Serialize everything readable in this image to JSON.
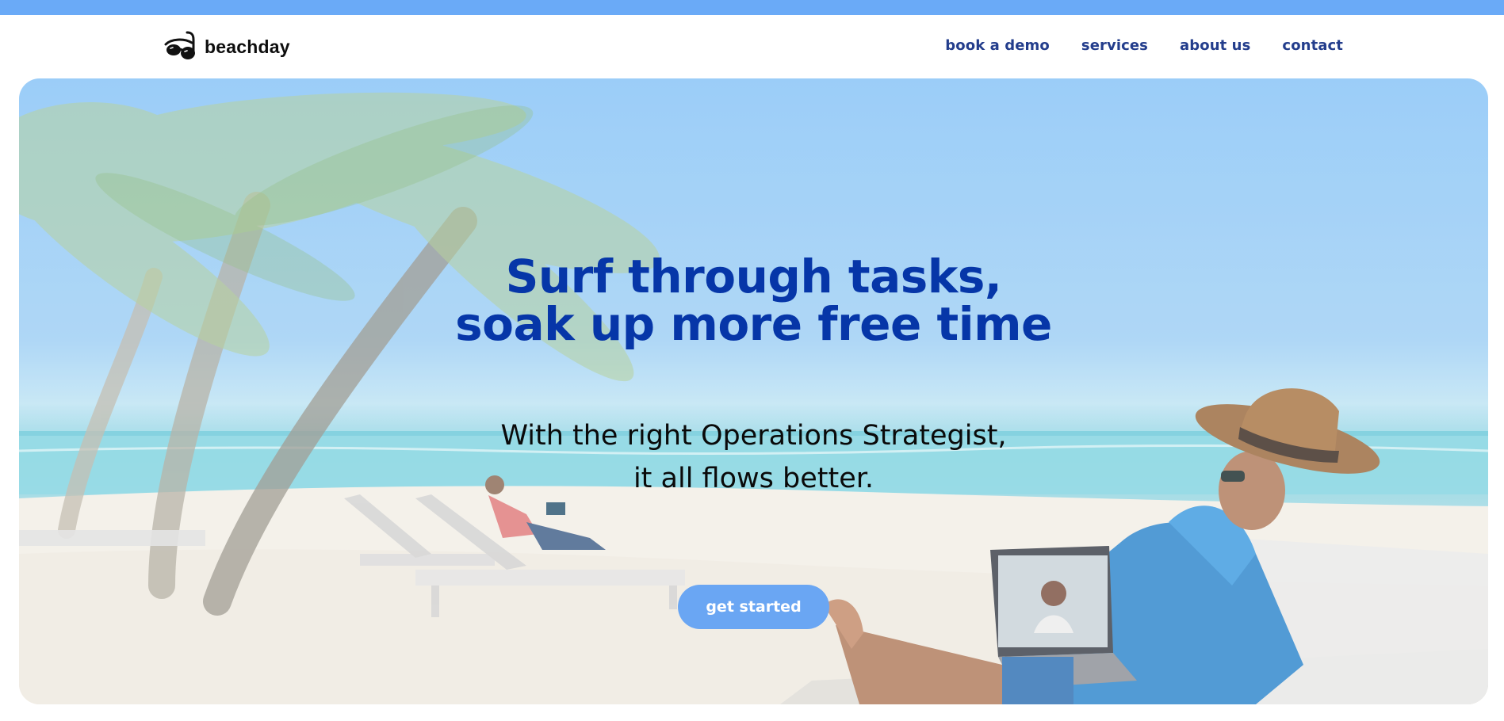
{
  "brand": {
    "name": "beachday",
    "logo": "sunglasses-snorkel-icon"
  },
  "nav": {
    "items": [
      {
        "label": "book a demo"
      },
      {
        "label": "services"
      },
      {
        "label": "about us"
      },
      {
        "label": "contact"
      }
    ]
  },
  "hero": {
    "headline_line1": "Surf through tasks,",
    "headline_line2": "soak up more free time",
    "subtext_line1": "With the right Operations Strategist,",
    "subtext_line2": "it all flows better.",
    "cta_label": "get started",
    "background_image": "beach-with-palm-trees-and-man-working-on-laptop"
  },
  "colors": {
    "top_strip": "#6aaaf7",
    "nav_link": "#233d8c",
    "headline": "#0636a8",
    "cta_background": "#6aa6f3",
    "cta_text": "#ffffff"
  }
}
